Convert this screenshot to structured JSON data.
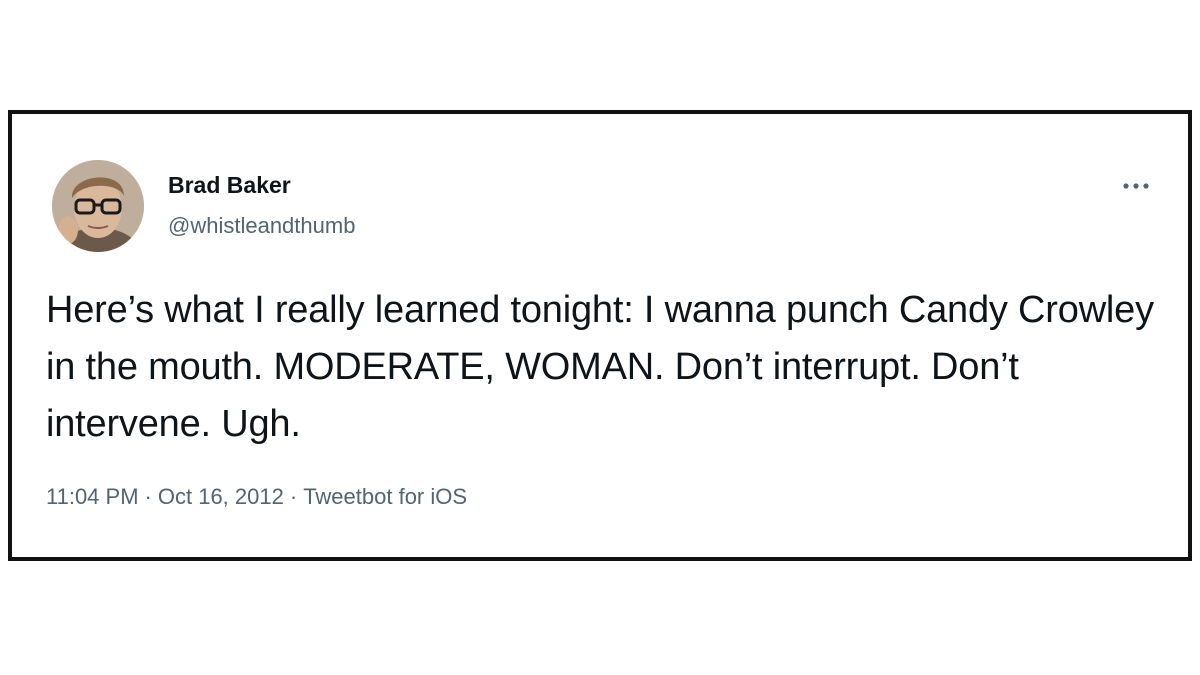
{
  "author": {
    "display_name": "Brad Baker",
    "handle": "@whistleandthumb",
    "avatar_icon": "profile-photo"
  },
  "tweet": {
    "text": "Here’s what I really learned tonight: I wanna punch Candy Crowley in the mouth. MODERATE, WOMAN. Don’t interrupt. Don’t intervene. Ugh."
  },
  "meta": {
    "time": "11:04 PM",
    "separator": "·",
    "date": "Oct 16, 2012",
    "source": "Tweetbot for iOS"
  },
  "menu": {
    "icon": "more-options-icon"
  },
  "colors": {
    "text_primary": "#0f1419",
    "text_secondary": "#536471",
    "border": "#111111"
  }
}
